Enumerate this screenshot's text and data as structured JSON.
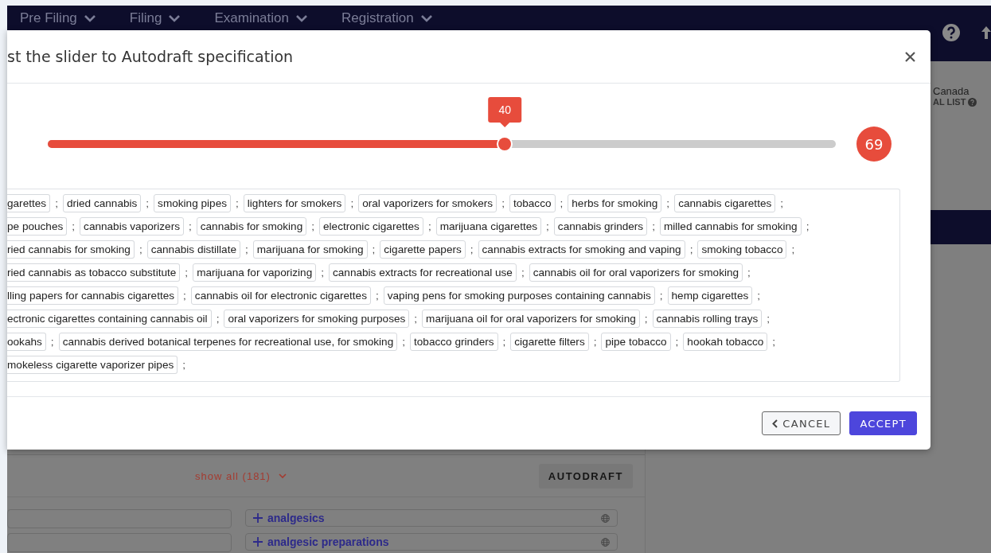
{
  "navbar": {
    "menus": [
      {
        "label": "Pre Filing"
      },
      {
        "label": "Filing"
      },
      {
        "label": "Examination"
      },
      {
        "label": "Registration"
      }
    ]
  },
  "background": {
    "office": "Canada",
    "list_label": "AL LIST",
    "show_all": "show all (181)",
    "autodraft": "AUTODRAFT",
    "terms": [
      {
        "label": "analgesics"
      },
      {
        "label": "analgesic preparations"
      }
    ]
  },
  "modal": {
    "title": "st the slider to Autodraft specification",
    "slider": {
      "level": 0.58,
      "value": "40",
      "max": "69"
    },
    "tag_lines": [
      [
        {
          "text": "garettes",
          "sep": ";"
        },
        {
          "text": "dried cannabis",
          "sep": ";"
        },
        {
          "text": "smoking pipes",
          "sep": ";"
        },
        {
          "text": "lighters for smokers",
          "sep": ";"
        },
        {
          "text": "oral vaporizers for smokers",
          "sep": ";"
        },
        {
          "text": "tobacco",
          "sep": ";"
        },
        {
          "text": "herbs for smoking",
          "sep": ";"
        },
        {
          "text": "cannabis cigarettes",
          "sep": ";"
        }
      ],
      [
        {
          "text": "pe pouches",
          "sep": ";"
        },
        {
          "text": "cannabis vaporizers",
          "sep": ";"
        },
        {
          "text": "cannabis for smoking",
          "sep": ";"
        },
        {
          "text": "electronic cigarettes",
          "sep": ";"
        },
        {
          "text": "marijuana cigarettes",
          "sep": ";"
        },
        {
          "text": "cannabis grinders",
          "sep": ";"
        },
        {
          "text": "milled cannabis for smoking",
          "sep": ";"
        }
      ],
      [
        {
          "text": "ried cannabis for smoking",
          "sep": ";"
        },
        {
          "text": "cannabis distillate",
          "sep": ";"
        },
        {
          "text": "marijuana for smoking",
          "sep": ";"
        },
        {
          "text": "cigarette papers",
          "sep": ";"
        },
        {
          "text": "cannabis extracts for smoking and vaping",
          "sep": ";"
        },
        {
          "text": "smoking tobacco",
          "sep": ";"
        }
      ],
      [
        {
          "text": "ried cannabis as tobacco substitute",
          "sep": ";"
        },
        {
          "text": "marijuana for vaporizing",
          "sep": ";"
        },
        {
          "text": "cannabis extracts for recreational use",
          "sep": ";"
        },
        {
          "text": "cannabis oil for oral vaporizers for smoking",
          "sep": ";"
        }
      ],
      [
        {
          "text": "lling papers for cannabis cigarettes",
          "sep": ";"
        },
        {
          "text": "cannabis oil for electronic cigarettes",
          "sep": ";"
        },
        {
          "text": "vaping pens for smoking purposes containing cannabis",
          "sep": ";"
        },
        {
          "text": "hemp cigarettes",
          "sep": ";"
        }
      ],
      [
        {
          "text": "ectronic cigarettes containing cannabis oil",
          "sep": ";"
        },
        {
          "text": "oral vaporizers for smoking purposes",
          "sep": ";"
        },
        {
          "text": "marijuana oil for oral vaporizers for smoking",
          "sep": ";"
        },
        {
          "text": "cannabis rolling trays",
          "sep": ";"
        }
      ],
      [
        {
          "text": "ookahs",
          "sep": ";"
        },
        {
          "text": "cannabis derived botanical terpenes for recreational use, for smoking",
          "sep": ";"
        },
        {
          "text": "tobacco grinders",
          "sep": ";"
        },
        {
          "text": "cigarette filters",
          "sep": ";"
        },
        {
          "text": "pipe tobacco",
          "sep": ";"
        },
        {
          "text": "hookah tobacco",
          "sep": ";"
        }
      ],
      [
        {
          "text": "mokeless cigarette vaporizer pipes",
          "sep": ";"
        }
      ]
    ],
    "buttons": [
      {
        "label": "CANCEL",
        "kind": "secondary"
      },
      {
        "label": "ACCEPT",
        "kind": "primary"
      }
    ]
  }
}
